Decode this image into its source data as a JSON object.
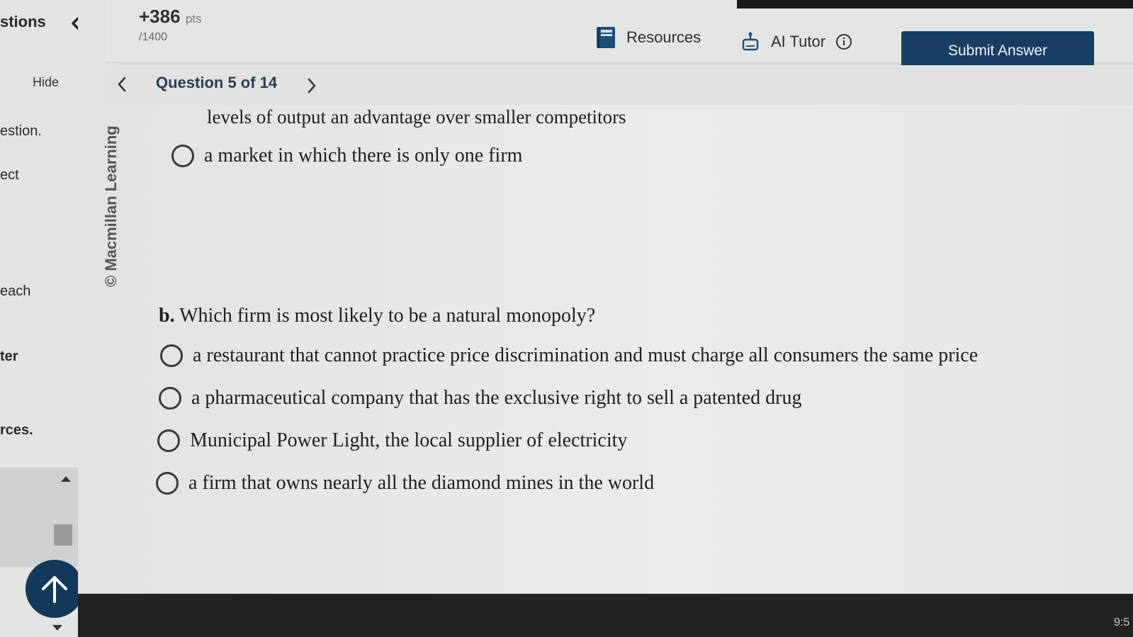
{
  "sidebar": {
    "title_fragment": "stions",
    "hide_label": "Hide",
    "fragments": [
      "estion.",
      "ect",
      "each",
      "ter",
      "rces."
    ]
  },
  "copyright": "© Macmillan Learning",
  "header": {
    "score": "+386",
    "score_unit": "pts",
    "score_total": "/1400",
    "resources_label": "Resources",
    "ai_tutor_label": "AI Tutor",
    "submit_label": "Submit Answer"
  },
  "nav": {
    "question_label": "Question 5 of 14"
  },
  "question_a": {
    "continued_text": "levels of output an advantage over smaller competitors",
    "last_option": "a market in which there is only one firm"
  },
  "question_b": {
    "letter": "b.",
    "prompt": "Which firm is most likely to be a natural monopoly?",
    "options": [
      "a restaurant that cannot practice price discrimination and must charge all consumers the same price",
      "a pharmaceutical company that has the exclusive right to sell a patented drug",
      "Municipal Power Light, the local supplier of electricity",
      "a firm that owns nearly all the diamond mines in the world"
    ]
  },
  "taskbar": {
    "clock": "9:5"
  },
  "colors": {
    "accent": "#173f63",
    "up_button": "#133a5c"
  }
}
